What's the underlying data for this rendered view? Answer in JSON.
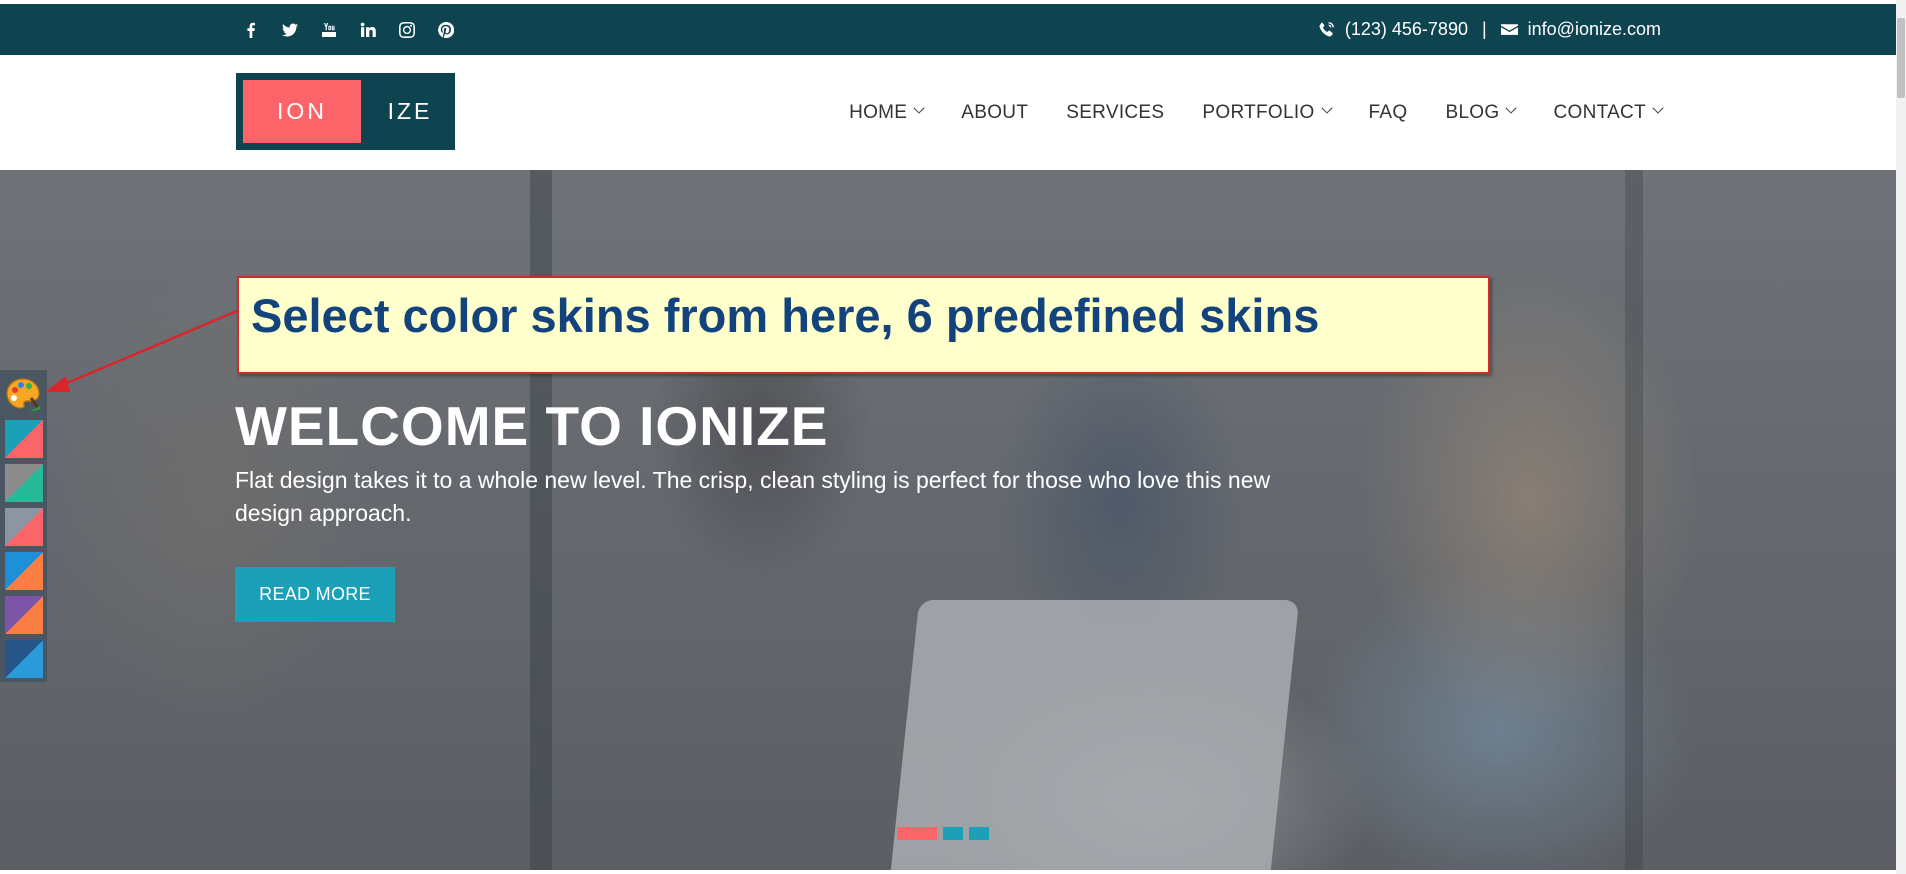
{
  "topbar": {
    "social_icons": [
      "facebook-icon",
      "twitter-icon",
      "youtube-icon",
      "linkedin-icon",
      "instagram-icon",
      "pinterest-icon"
    ],
    "phone": "(123) 456-7890",
    "separator": "|",
    "email": "info@ionize.com"
  },
  "logo": {
    "left": "ION",
    "right": "IZE"
  },
  "nav": {
    "items": [
      {
        "label": "HOME",
        "dropdown": true
      },
      {
        "label": "ABOUT",
        "dropdown": false
      },
      {
        "label": "SERVICES",
        "dropdown": false
      },
      {
        "label": "PORTFOLIO",
        "dropdown": true
      },
      {
        "label": "FAQ",
        "dropdown": false
      },
      {
        "label": "BLOG",
        "dropdown": true
      },
      {
        "label": "CONTACT",
        "dropdown": true
      }
    ]
  },
  "hero": {
    "title": "WELCOME TO IONIZE",
    "text": "Flat design takes it to a whole new level. The crisp, clean styling is perfect for those who love this new design approach.",
    "button": "READ MORE",
    "slides": 3,
    "active_slide": 1
  },
  "annotation": {
    "text": "Select color skins from here, 6 predefined skins"
  },
  "skins": [
    {
      "a": "#1ba0b8",
      "b": "#fb6569"
    },
    {
      "a": "#8c8c8c",
      "b": "#27b89a"
    },
    {
      "a": "#8c96a2",
      "b": "#fb6569"
    },
    {
      "a": "#1e90d8",
      "b": "#fb7e45"
    },
    {
      "a": "#7d55a8",
      "b": "#fb7e45"
    },
    {
      "a": "#26558a",
      "b": "#2a9ad8"
    }
  ],
  "colors": {
    "topbar": "#0e4350",
    "accent": "#fb6569",
    "button": "#1ba0b8"
  }
}
